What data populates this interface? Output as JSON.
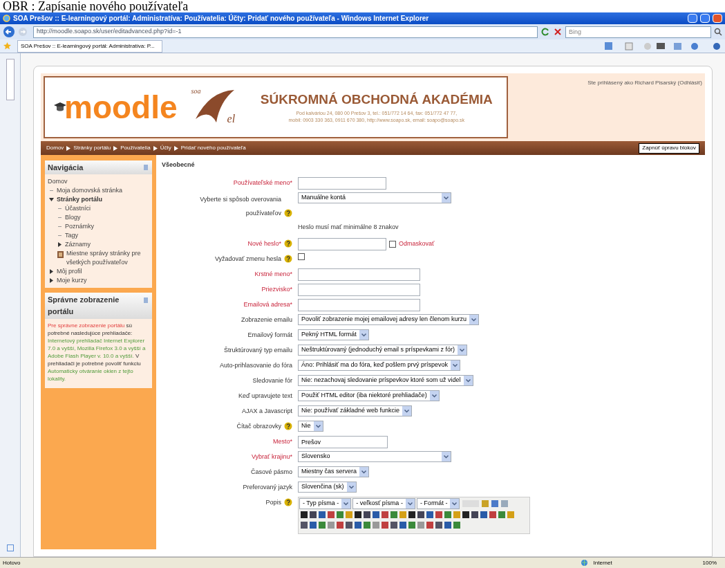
{
  "caption": "OBR : Zapísanie nového používateľa",
  "browser": {
    "title": "SOA Prešov :: E-learningový portál: Administratíva: Používatelia: Účty: Pridať nového používateľa - Windows Internet Explorer",
    "address": "http://moodle.soapo.sk/user/editadvanced.php?id=-1",
    "search_placeholder": "Bing",
    "tab": "SOA Prešov :: E-learningový portál: Administratíva: P...",
    "status": "Hotovo",
    "zone": "Internet",
    "zoom": "100%"
  },
  "header": {
    "logo": "moodle",
    "emblem": [
      "soa",
      "el"
    ],
    "school": "SÚKROMNÁ OBCHODNÁ AKADÉMIA",
    "contact": [
      "Pod kalváriou 24, 080 00 Prešov 3, tel.: 051/772 14 64, fax: 051/772 47 77,",
      "mobil: 0903 330 363, 0911 670 380, http://www.soapo.sk, email: soapo@soapo.sk"
    ],
    "login": "Ste prihlásený ako Richard Pisarský (Odhlásiť)"
  },
  "breadcrumb": [
    "Domov",
    "Stránky portálu",
    "Používatelia",
    "Účty",
    "Pridať nového používateľa"
  ],
  "edit_blocks_button": "Zapnúť úpravu blokov",
  "navigation": {
    "title": "Navigácia",
    "root": "Domov",
    "items": [
      {
        "label": "Moja domovská stránka",
        "kind": "leaf"
      },
      {
        "label": "Stránky portálu",
        "kind": "branch",
        "expanded": true,
        "children": [
          {
            "label": "Účastníci",
            "kind": "leaf"
          },
          {
            "label": "Blogy",
            "kind": "leaf"
          },
          {
            "label": "Poznámky",
            "kind": "leaf"
          },
          {
            "label": "Tagy",
            "kind": "leaf"
          },
          {
            "label": "Záznamy",
            "kind": "branch",
            "expanded": false
          },
          {
            "label": "Miestne správy stránky pre všetkých používateľov",
            "kind": "page"
          }
        ]
      },
      {
        "label": "Môj profil",
        "kind": "branch",
        "expanded": false
      },
      {
        "label": "Moje kurzy",
        "kind": "branch",
        "expanded": false
      }
    ]
  },
  "notice": {
    "title": "Správne zobrazenie portálu",
    "text": [
      {
        "text": "Pre správne zobrazenie portálu",
        "kind": "warning"
      },
      {
        "text": "sú potrebné nasledujúce prehliadače:",
        "kind": "plain"
      },
      {
        "text": "Internetový prehliadač Internet Explorer 7.0 a vyšší, Mozilla Firefox 3.0 a vyšší a Adobe Flash Player v. 10.0 a vyšší.",
        "kind": "info"
      },
      {
        "text": "V prehliadači je potrebné povoliť funkciu",
        "kind": "plain"
      },
      {
        "text": "Automaticky otváranie okien z tejto lokality.",
        "kind": "info"
      }
    ]
  },
  "form": {
    "legend": "Všeobecné",
    "rows": [
      {
        "kind": "text",
        "label": "Používateľské meno*",
        "required": true
      },
      {
        "kind": "select",
        "label": "Vyberte si spôsob overovania používateľov",
        "help": true,
        "value": "Manuálne kontá"
      },
      {
        "kind": "note",
        "text": "Heslo musí mať minimálne 8 znakov"
      },
      {
        "kind": "password",
        "label": "Nové heslo*",
        "required": true,
        "help": true,
        "unmask": "Odmaskovať",
        "checked": false
      },
      {
        "kind": "checkbox",
        "label": "Vyžadovať zmenu hesla",
        "help": true,
        "checked": false
      },
      {
        "kind": "text",
        "label": "Krstné meno*",
        "required": true
      },
      {
        "kind": "text",
        "label": "Priezvisko*",
        "required": true
      },
      {
        "kind": "text",
        "label": "Emailová adresa*",
        "required": true
      },
      {
        "kind": "select",
        "label": "Zobrazenie emailu",
        "value": "Povoliť zobrazenie mojej emailovej adresy len členom kurzu"
      },
      {
        "kind": "select",
        "label": "Emailový formát",
        "value": "Pekný HTML formát"
      },
      {
        "kind": "select",
        "label": "Štruktúrovaný typ emailu",
        "value": "Neštruktúrovaný (jednoduchý email s príspevkami z fór)"
      },
      {
        "kind": "select",
        "label": "Auto-prihlasovanie do fóra",
        "value": "Áno: Prihlásiť ma do fóra, keď pošlem prvý príspevok"
      },
      {
        "kind": "select",
        "label": "Sledovanie fór",
        "value": "Nie: nezachovaj sledovanie príspevkov ktoré som už videl"
      },
      {
        "kind": "select",
        "label": "Keď upravujete text",
        "value": "Použiť HTML editor (iba niektoré prehliadače)"
      },
      {
        "kind": "select",
        "label": "AJAX a Javascript",
        "value": "Nie: používať základné web funkcie"
      },
      {
        "kind": "select",
        "label": "Čítač obrazovky",
        "help": true,
        "value": "Nie"
      },
      {
        "kind": "text",
        "label": "Mesto*",
        "required": true,
        "value": "Prešov"
      },
      {
        "kind": "select",
        "label": "Vybrať krajinu*",
        "required": true,
        "value": "Slovensko"
      },
      {
        "kind": "select",
        "label": "Časové pásmo",
        "value": "Miestny čas servera"
      },
      {
        "kind": "select",
        "label": "Preferovaný jazyk",
        "value": "Slovenčina (sk)"
      },
      {
        "kind": "editor",
        "label": "Popis",
        "help": true,
        "selects": [
          "- Typ písma -",
          "- veľkosť písma -",
          "- Formát -"
        ]
      }
    ]
  }
}
